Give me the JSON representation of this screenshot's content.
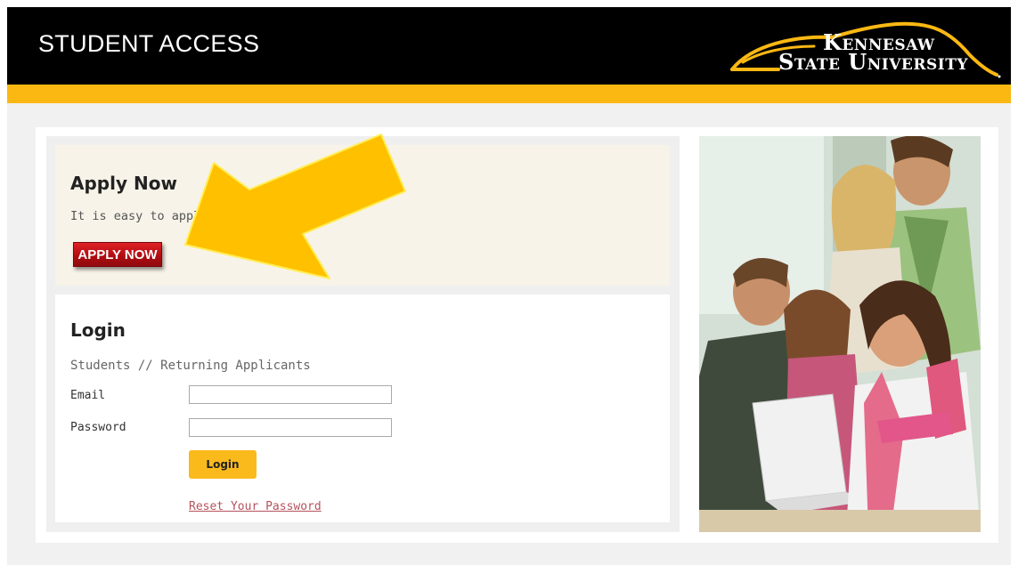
{
  "header": {
    "title": "STUDENT ACCESS",
    "logo_line1": "Kennesaw",
    "logo_line2": "State University"
  },
  "apply": {
    "heading": "Apply Now",
    "text": "It is easy to apply.",
    "button_label": "APPLY NOW"
  },
  "login": {
    "heading": "Login",
    "subtitle": "Students // Returning Applicants",
    "email_label": "Email",
    "email_value": "",
    "password_label": "Password",
    "password_value": "",
    "button_label": "Login",
    "reset_link": "Reset Your Password"
  },
  "colors": {
    "header_bg": "#000000",
    "accent_gold": "#fbb812",
    "apply_panel_bg": "#f8f3e9",
    "apply_button_red": "#b10d12",
    "login_button": "#fbba1b",
    "link_color": "#b5525c",
    "annotation_arrow": "#ffc000"
  },
  "icons": {
    "annotation": "arrow-pointing-icon",
    "logo": "kennesaw-state-logo"
  }
}
